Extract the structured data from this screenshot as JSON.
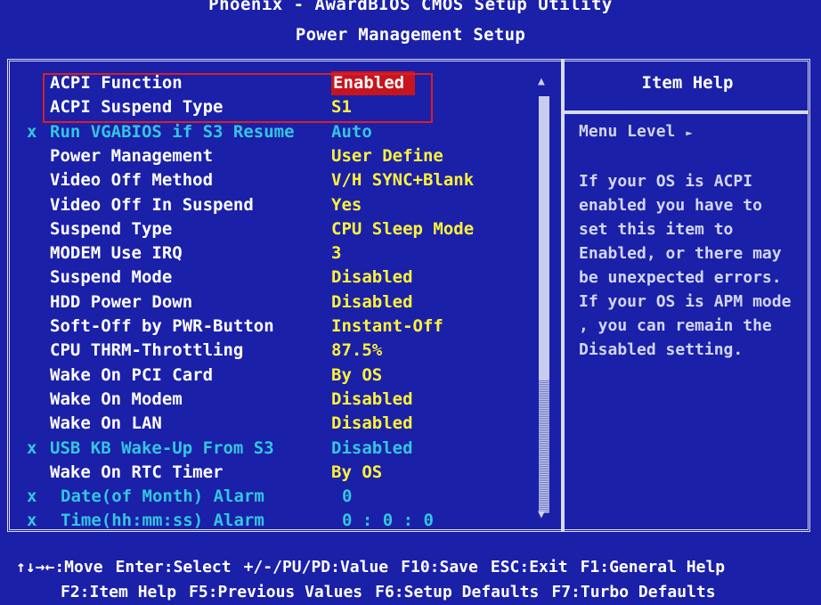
{
  "header": {
    "title": "Phoenix - AwardBIOS CMOS Setup Utility",
    "subtitle": "Power Management Setup"
  },
  "settings": [
    {
      "label": "ACPI Function",
      "value": "Enabled",
      "disabled": false,
      "selected": true
    },
    {
      "label": "ACPI Suspend Type",
      "value": "S1",
      "disabled": false
    },
    {
      "label": "Run VGABIOS if S3 Resume",
      "value": "Auto",
      "disabled": true,
      "mark": "x"
    },
    {
      "label": "Power Management",
      "value": "User Define",
      "disabled": false
    },
    {
      "label": "Video Off Method",
      "value": "V/H SYNC+Blank",
      "disabled": false
    },
    {
      "label": "Video Off In Suspend",
      "value": "Yes",
      "disabled": false
    },
    {
      "label": "Suspend Type",
      "value": "CPU Sleep Mode",
      "disabled": false
    },
    {
      "label": "MODEM Use IRQ",
      "value": "3",
      "disabled": false
    },
    {
      "label": "Suspend Mode",
      "value": "Disabled",
      "disabled": false
    },
    {
      "label": "HDD Power Down",
      "value": "Disabled",
      "disabled": false
    },
    {
      "label": "Soft-Off by PWR-Button",
      "value": "Instant-Off",
      "disabled": false
    },
    {
      "label": "CPU THRM-Throttling",
      "value": "87.5%",
      "disabled": false
    },
    {
      "label": "Wake On PCI Card",
      "value": "By OS",
      "disabled": false
    },
    {
      "label": "Wake On Modem",
      "value": "Disabled",
      "disabled": false
    },
    {
      "label": "Wake On LAN",
      "value": "Disabled",
      "disabled": false
    },
    {
      "label": "USB KB Wake-Up From S3",
      "value": "Disabled",
      "disabled": true,
      "mark": "x"
    },
    {
      "label": "Wake On RTC Timer",
      "value": "By OS",
      "disabled": false
    },
    {
      "label": "Date(of Month) Alarm",
      "value": "0",
      "disabled": true,
      "mark": "x"
    },
    {
      "label": "Time(hh:mm:ss) Alarm",
      "value": "0  :  0  :  0",
      "disabled": true,
      "mark": "x"
    }
  ],
  "scroll": {
    "up_icon": "▲",
    "down_icon": "▼"
  },
  "help": {
    "title": "Item Help",
    "menu_level": "Menu Level",
    "menu_level_icon": "►",
    "lines": [
      "If your OS is ACPI",
      "enabled you have to",
      "set this item to",
      "Enabled, or there may",
      "be unexpected errors.",
      "If your OS is APM mode",
      ", you can remain the",
      "Disabled setting."
    ]
  },
  "footer": {
    "line1": [
      "↑↓→←:Move",
      "Enter:Select",
      "+/-/PU/PD:Value",
      "F10:Save",
      "ESC:Exit",
      "F1:General Help"
    ],
    "line2": [
      "F2:Item Help",
      "F5:Previous Values",
      "F6:Setup Defaults",
      "F7:Turbo Defaults"
    ]
  },
  "colors": {
    "background": "#1a20a8",
    "value": "#fff23a",
    "disabled": "#33c6e0",
    "selected": "#c8141e"
  }
}
